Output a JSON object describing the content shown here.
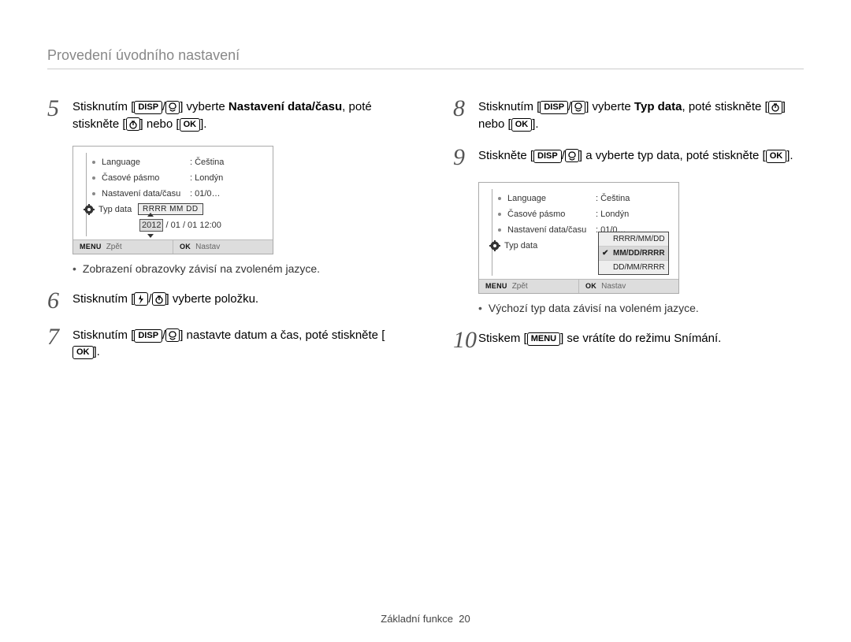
{
  "header": "Provedení úvodního nastavení",
  "footer": {
    "section": "Základní funkce",
    "page": "20"
  },
  "icons": {
    "disp": "DISP",
    "ok": "OK",
    "menu": "MENU"
  },
  "steps": {
    "5": {
      "pre": "Stisknutím [",
      "mid": "] vyberte ",
      "bold": "Nastavení data/času",
      "post1": ", poté stiskněte [",
      "post2": "] nebo [",
      "post3": "]."
    },
    "6": {
      "pre": "Stisknutím [",
      "post": "] vyberte položku."
    },
    "7": {
      "pre": "Stisknutím [",
      "mid": "] nastavte datum a čas, poté stiskněte [",
      "post": "]."
    },
    "8": {
      "pre": "Stisknutím [",
      "mid": "] vyberte ",
      "bold": "Typ data",
      "post1": ", poté stiskněte [",
      "post2": "] nebo [",
      "post3": "]."
    },
    "9": {
      "pre": "Stiskněte [",
      "mid": "] a vyberte typ data, poté stiskněte [",
      "post": "]."
    },
    "10": {
      "pre": "Stiskem [",
      "post": "] se vrátíte do režimu Snímání."
    }
  },
  "screen1": {
    "rows": [
      {
        "label": "Language",
        "value": ": Čeština"
      },
      {
        "label": "Časové pásmo",
        "value": ": Londýn"
      },
      {
        "label": "Nastavení data/času",
        "value": ": 01/0…"
      },
      {
        "label": "Typ data",
        "value": ""
      }
    ],
    "date_format_header": "RRRR MM DD",
    "date_year": "2012",
    "date_rest": " / 01 / 01 12:00",
    "status": {
      "back_lbl": "MENU",
      "back_txt": "Zpět",
      "ok_lbl": "OK",
      "ok_txt": "Nastav"
    }
  },
  "screen2": {
    "rows": [
      {
        "label": "Language",
        "value": ": Čeština"
      },
      {
        "label": "Časové pásmo",
        "value": ": Londýn"
      },
      {
        "label": "Nastavení data/času",
        "value": ": 01/0…"
      },
      {
        "label": "Typ data",
        "value": ""
      }
    ],
    "options": [
      "RRRR/MM/DD",
      "MM/DD/RRRR",
      "DD/MM/RRRR"
    ],
    "selected": 1,
    "status": {
      "back_lbl": "MENU",
      "back_txt": "Zpět",
      "ok_lbl": "OK",
      "ok_txt": "Nastav"
    }
  },
  "notes": {
    "left": "Zobrazení obrazovky závisí na zvoleném jazyce.",
    "right": "Výchozí typ data závisí na voleném jazyce."
  }
}
